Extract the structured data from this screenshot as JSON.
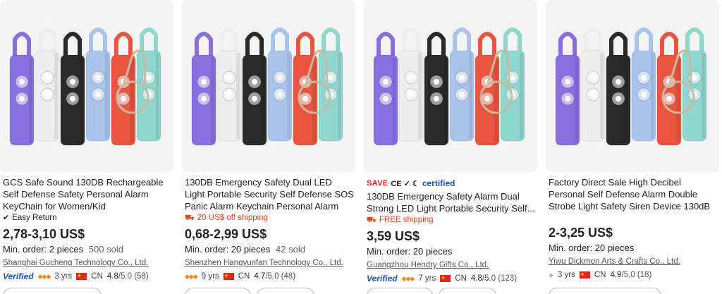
{
  "products": [
    {
      "title": "GCS Safe Sound 130DB Rechargeable Self Defense Safety Personal Alarm KeyChain for Women/Kid",
      "feature_icon": "shield-check-icon",
      "feature": "Easy Return",
      "price": "2,78-3,10 US$",
      "min_order": "Min. order: 2 pieces",
      "sold": "500 sold",
      "supplier": "Shanghai Gucheng Technology Co., Ltd.",
      "verified": "Verified",
      "years": "3 yrs",
      "country": "CN",
      "rating": "4.8",
      "rating_suffix": "/5.0 (58)"
    },
    {
      "title": "130DB Emergency Safety Dual LED Light Portable Security Self Defense SOS Panic Alarm Keychain Personal Alarm for...",
      "feature_icon": "truck-icon",
      "feature": "20 US$ off shipping",
      "price": "0,68-2,99 US$",
      "min_order": "Min. order: 20 pieces",
      "sold": "42 sold",
      "supplier": "Shenzhen Hangyunfan Technology Co., Ltd.",
      "years": "9 yrs",
      "country": "CN",
      "rating": "4.7",
      "rating_suffix": "/5.0 (48)"
    },
    {
      "save": "SAVE",
      "cert_marks": "CE ✓ ☾",
      "cert_label": "certified",
      "title": "130DB Emergency Safety Alarm Dual Strong LED Light Portable Security Self...",
      "feature_icon": "truck-icon",
      "feature": "FREE shipping",
      "price": "3,59 US$",
      "min_order": "Min. order: 20 pieces",
      "supplier": "Guangzhou Hendry Gifts Co., Ltd.",
      "verified": "Verified",
      "years": "7 yrs",
      "country": "CN",
      "rating": "4.8",
      "rating_suffix": "/5.0 (123)"
    },
    {
      "title": "Factory Direct Sale High Decibel Personal Self Defense Alarm Double Strobe Light Safety Siren Device 130dB Emergency...",
      "price": "2-3,25 US$",
      "min_order": "Min. order: 20 pieces",
      "supplier": "Yiwu Dickmon Arts & Crafts Co., Ltd.",
      "years": "3 yrs",
      "country": "CN",
      "rating": "4.9",
      "rating_suffix": "/5.0 (18)"
    }
  ],
  "colors": {
    "alarm_purple": "#8a6fe0",
    "alarm_white": "#eeeeee",
    "alarm_black": "#2a2a2a",
    "alarm_blue": "#a9c4ec",
    "alarm_red": "#e9553f",
    "alarm_teal": "#8fd6cf",
    "shipping_orange": "#e0431a",
    "verified_blue": "#1a56c4"
  }
}
